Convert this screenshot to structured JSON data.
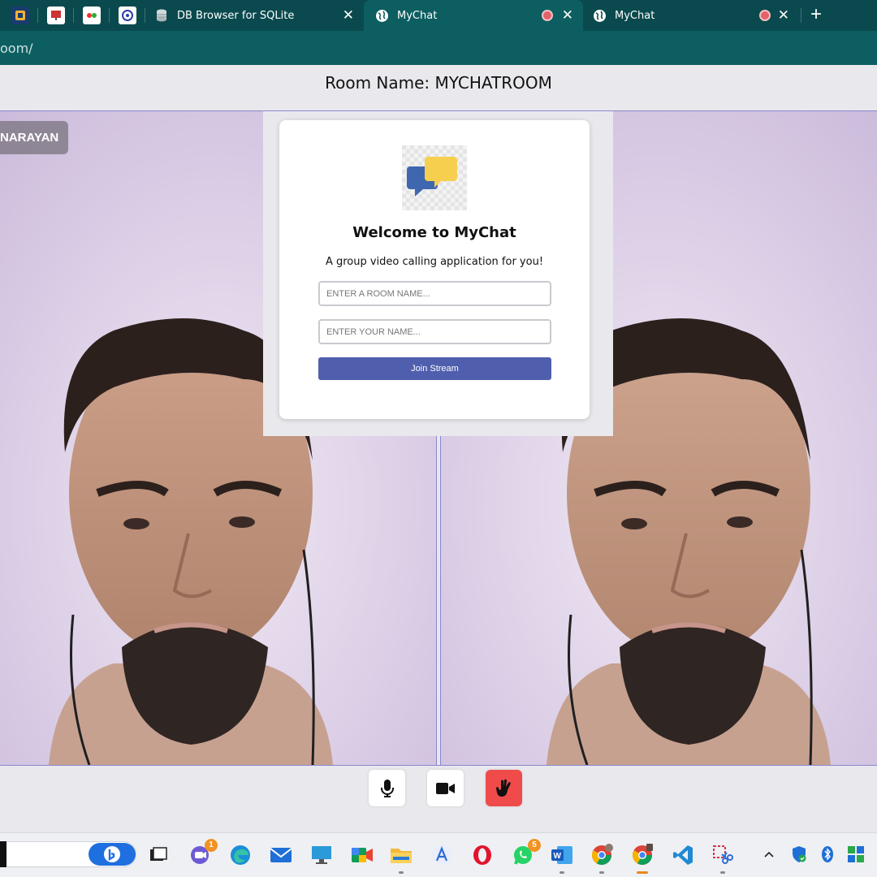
{
  "browser": {
    "tabs": [
      {
        "title": "DB Browser for SQLite",
        "icon": "database-icon",
        "active": false
      },
      {
        "title": "MyChat",
        "icon": "globe-icon",
        "active": true,
        "recording": true
      },
      {
        "title": "MyChat",
        "icon": "globe-icon",
        "active": false,
        "recording": true
      }
    ],
    "url": "oom/",
    "new_tab_label": "+",
    "close_glyph": "✕"
  },
  "page": {
    "room_title": "Room Name: MYCHATROOM",
    "participant_name": "NARAYAN"
  },
  "join_card": {
    "welcome": "Welcome to MyChat",
    "tagline": "A group video calling application for you!",
    "room_placeholder": "ENTER A ROOM NAME...",
    "name_placeholder": "ENTER YOUR NAME...",
    "join_label": "Join Stream"
  },
  "controls": [
    {
      "name": "mic-button",
      "icon": "microphone-icon"
    },
    {
      "name": "camera-button",
      "icon": "video-camera-icon"
    },
    {
      "name": "leave-button",
      "icon": "hand-icon",
      "color": "#f04b4b"
    }
  ],
  "taskbar": {
    "apps": [
      {
        "name": "teams",
        "badge": "1"
      },
      {
        "name": "whatsapp",
        "badge": "5"
      }
    ]
  },
  "colors": {
    "browser_dark": "#0a4a4e",
    "browser_active": "#0d5e61",
    "join_button": "#4f5fae",
    "leave_button": "#f04b4b",
    "stage_border": "#8a86cc"
  }
}
